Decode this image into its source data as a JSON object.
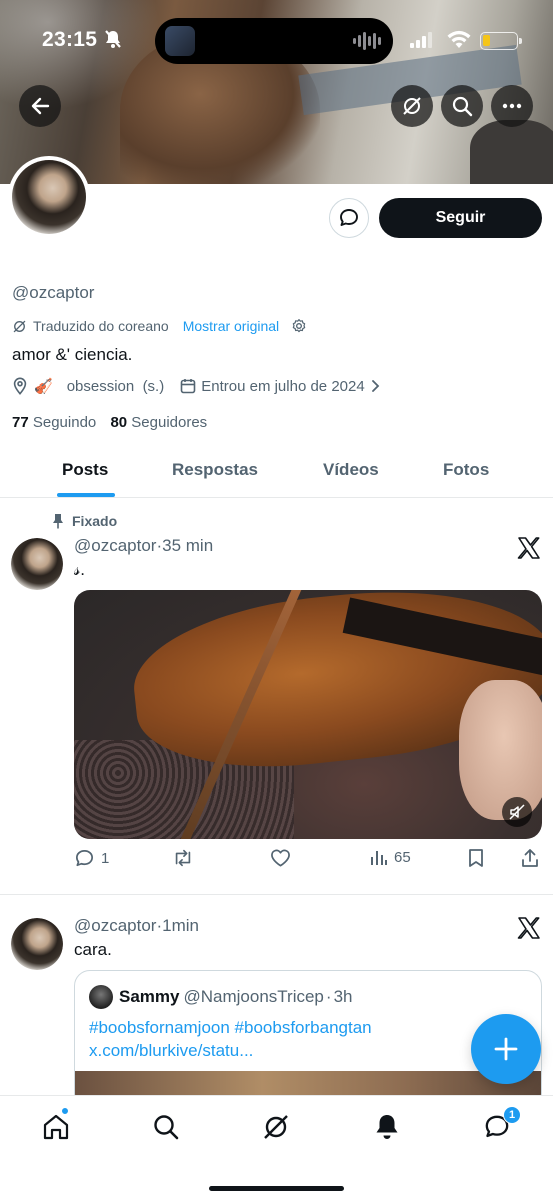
{
  "status": {
    "time": "23:15",
    "battery_color": "#f5c518"
  },
  "header": {
    "back_icon": "arrow-left-icon",
    "grok_icon": "grok-icon",
    "search_icon": "search-icon",
    "more_icon": "more-horizontal-icon"
  },
  "profile": {
    "handle": "@ozcaptor",
    "translated_label": "Traduzido do coreano",
    "show_original": "Mostrar original",
    "bio": "amor &' ciencia.",
    "location_emoji": "🎻",
    "location_text": "obsession  (s.)",
    "joined": "Entrou em julho de 2024",
    "following_count": "77",
    "following_label": "Seguindo",
    "followers_count": "80",
    "followers_label": "Seguidores",
    "follow_button": "Seguir"
  },
  "tabs": [
    "Posts",
    "Respostas",
    "Vídeos",
    "Fotos"
  ],
  "posts": [
    {
      "pinned_label": "Fixado",
      "handle": "@ozcaptor",
      "sep": "·",
      "time": "35 min",
      "text": "𝓈.",
      "replies": "1",
      "views": "65"
    },
    {
      "handle": "@ozcaptor",
      "sep": "·",
      "time": "1min",
      "text": "cara.",
      "quote": {
        "name": "Sammy",
        "handle": "@NamjoonsTricep",
        "sep": "·",
        "time": "3h",
        "text": "#boobsfornamjoon #boobsforbangtan x.com/blurkive/statu..."
      }
    }
  ],
  "nav": {
    "messages_badge": "1"
  },
  "colors": {
    "accent": "#1d9bf0",
    "text": "#0f1419",
    "muted": "#536471"
  }
}
